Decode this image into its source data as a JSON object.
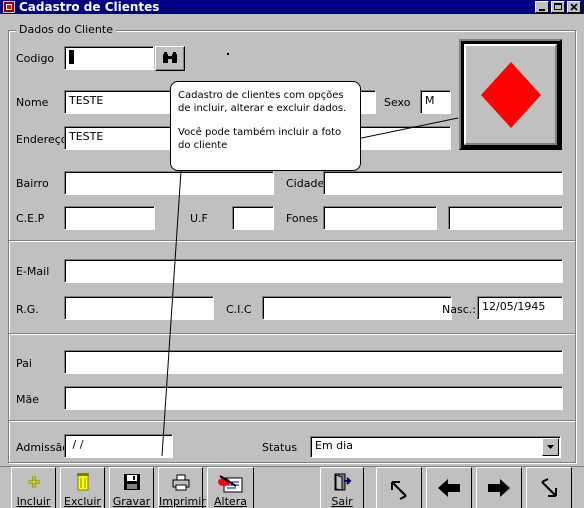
{
  "window": {
    "title": "Cadastro de Clientes"
  },
  "group": {
    "legend": "Dados do Cliente"
  },
  "fields": {
    "codigo": {
      "label": "Codigo",
      "value": "1"
    },
    "nome": {
      "label": "Nome",
      "value": "TESTE"
    },
    "sexo": {
      "label": "Sexo",
      "value": "M"
    },
    "endereco": {
      "label": "Endereço",
      "value": "TESTE"
    },
    "bairro": {
      "label": "Bairro",
      "value": ""
    },
    "cidade": {
      "label": "Cidade",
      "value": ""
    },
    "cep": {
      "label": "C.E.P",
      "value": ""
    },
    "uf": {
      "label": "U.F",
      "value": ""
    },
    "fones": {
      "label": "Fones",
      "value1": "",
      "value2": ""
    },
    "email": {
      "label": "E-Mail",
      "value": ""
    },
    "rg": {
      "label": "R.G.",
      "value": ""
    },
    "cic": {
      "label": "C.I.C",
      "value": ""
    },
    "nasc": {
      "label": "Nasc.:",
      "value": "12/05/1945"
    },
    "pai": {
      "label": "Pai",
      "value": ""
    },
    "mae": {
      "label": "Mãe",
      "value": ""
    },
    "admissao": {
      "label": "Admissão",
      "value": " / /"
    },
    "status": {
      "label": "Status",
      "value": "Em dia"
    }
  },
  "tooltip": {
    "line1": "Cadastro de clientes com opções de incluir, alterar e excluir dados.",
    "line2": "Você pode também incluir a foto do cliente"
  },
  "toolbar": {
    "incluir": "Incluir",
    "excluir": "Excluir",
    "gravar": "Gravar",
    "imprimir": "Imprimir",
    "altera": "Altera",
    "sair": "Sair"
  },
  "colors": {
    "titlebar": "#000080",
    "face": "#c0c0c0",
    "photo_diamond": "#ff0000"
  }
}
